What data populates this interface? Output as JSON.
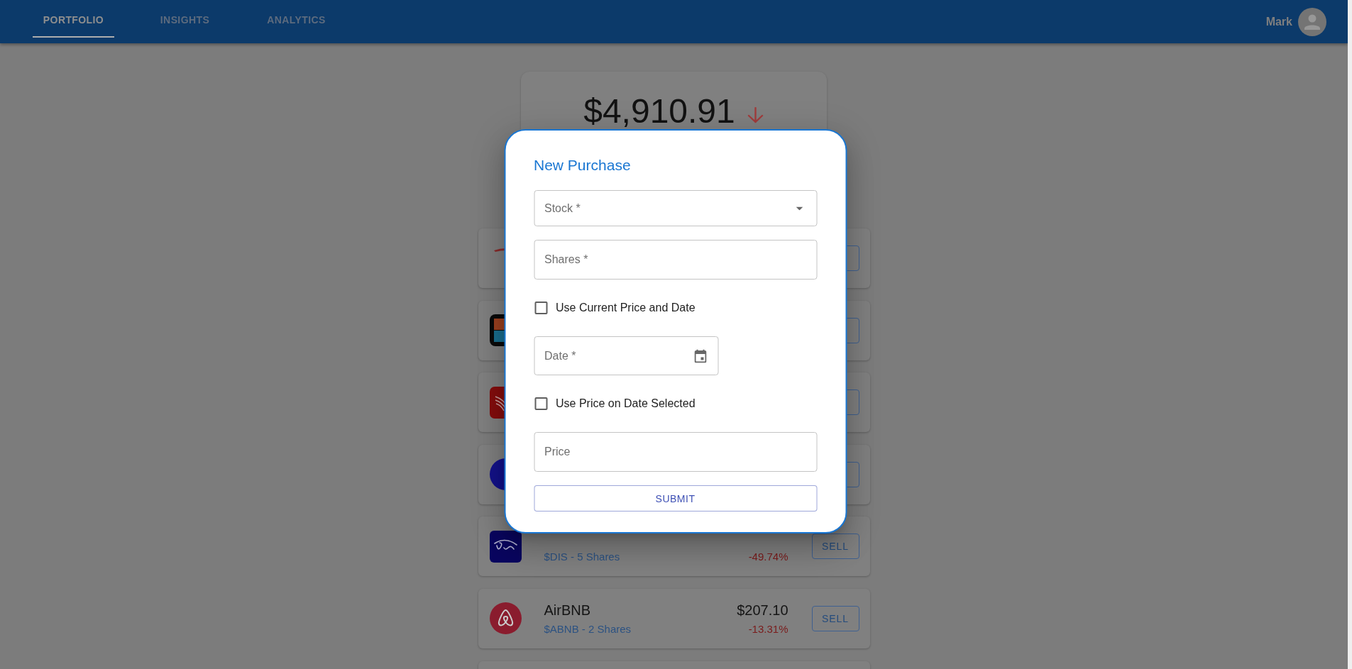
{
  "app_bar": {
    "tabs": [
      {
        "label": "PORTFOLIO",
        "selected": true
      },
      {
        "label": "INSIGHTS",
        "selected": false
      },
      {
        "label": "ANALYTICS",
        "selected": false
      }
    ],
    "user": {
      "name": "Mark"
    }
  },
  "portfolio": {
    "total": "$4,910.91",
    "falling": true,
    "holdings": [
      {
        "kind": "t"
      },
      {
        "kind": "tiles"
      },
      {
        "kind": "wing"
      },
      {
        "kind": "circle"
      },
      {
        "kind": "script",
        "shares": "$DIS - 5 Shares",
        "change": "-49.74%",
        "loss": true,
        "action": "SELL"
      },
      {
        "kind": "loop",
        "name": "AirBNB",
        "price": "$207.10",
        "shares": "$ABNB - 2 Shares",
        "change": "-13.31%",
        "loss": true,
        "action": "SELL"
      },
      {
        "kind": "blank"
      }
    ]
  },
  "dialog": {
    "title": "New Purchase",
    "fields": [
      {
        "kind": "select",
        "placeholder": "Stock *"
      },
      {
        "kind": "text",
        "placeholder": "Shares *"
      },
      {
        "kind": "checkbox",
        "label": "Use Current Price and Date",
        "checked": false
      },
      {
        "kind": "date",
        "placeholder": "Date *"
      },
      {
        "kind": "checkbox",
        "label": "Use Price on Date Selected",
        "checked": false
      },
      {
        "kind": "text",
        "placeholder": "Price"
      }
    ],
    "submit": "SUBMIT"
  }
}
